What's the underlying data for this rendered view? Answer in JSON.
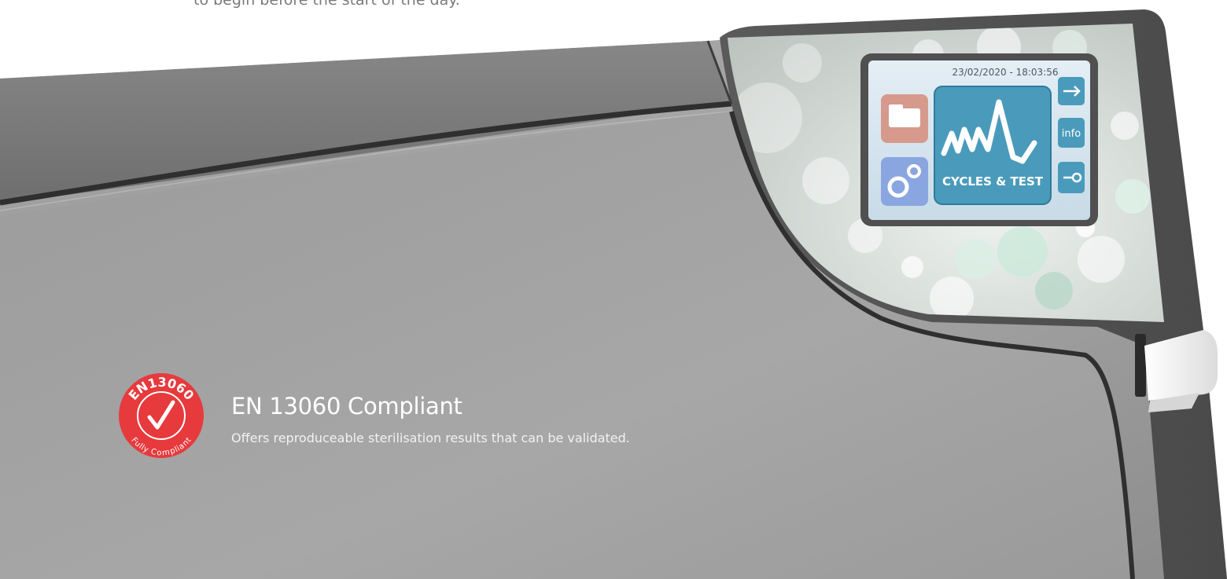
{
  "top_caption": "to begin before the start of the day.",
  "device": {
    "screen_datetime": "23/02/2020 - 18:03:56",
    "main_tile_label": "CYCLES & TEST",
    "info_button_label": "info",
    "icons": [
      "folder-icon",
      "gears-icon",
      "waveform-icon",
      "usb-icon",
      "key-icon"
    ]
  },
  "badge": {
    "top_text": "EN13060",
    "bottom_text": "Fully Compliant",
    "color": "#e63a3d"
  },
  "feature": {
    "title": "EN 13060 Compliant",
    "description": "Offers reproduceable sterilisation results that can be validated."
  }
}
